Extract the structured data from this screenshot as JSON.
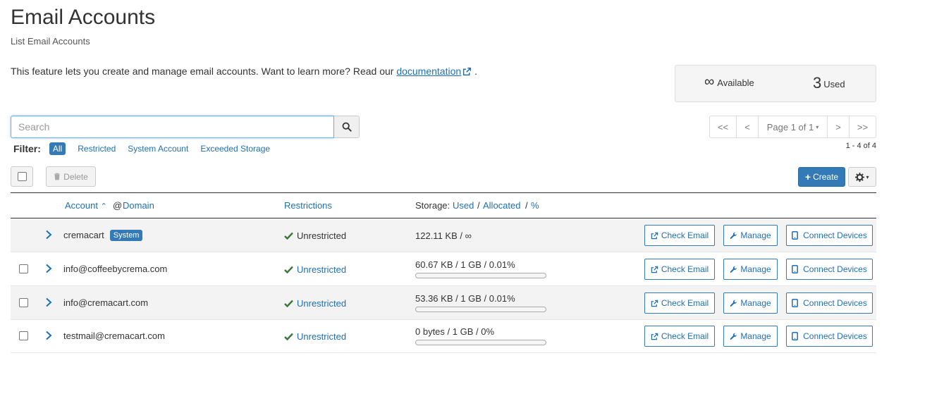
{
  "header": {
    "title": "Email Accounts",
    "subtitle": "List Email Accounts"
  },
  "intro": {
    "text": "This feature lets you create and manage email accounts. Want to learn more? Read our ",
    "link": "documentation",
    "suffix": "."
  },
  "stats": {
    "available_symbol": "∞",
    "available_label": "Available",
    "used_value": "3",
    "used_label": "Used"
  },
  "search": {
    "placeholder": "Search",
    "value": ""
  },
  "filter": {
    "label": "Filter:",
    "options": [
      {
        "label": "All",
        "active": true
      },
      {
        "label": "Restricted",
        "active": false
      },
      {
        "label": "System Account",
        "active": false
      },
      {
        "label": "Exceeded Storage",
        "active": false
      }
    ]
  },
  "pager": {
    "first": "<<",
    "prev": "<",
    "page": "Page 1 of 1",
    "next": ">",
    "last": ">>",
    "range": "1 - 4 of 4"
  },
  "toolbar": {
    "delete_label": "Delete",
    "create_label": "Create"
  },
  "columns": {
    "account": "Account",
    "at": "@",
    "domain": "Domain",
    "restrictions": "Restrictions",
    "storage": "Storage:",
    "used": "Used",
    "allocated": "Allocated",
    "percent": "%",
    "sep": "/"
  },
  "rows": [
    {
      "account": "cremacart",
      "badge": "System",
      "restriction": "Unrestricted",
      "storage": "122.11 KB / ∞",
      "usage_pct": null,
      "has_checkbox": false
    },
    {
      "account": "info@coffeebycrema.com",
      "badge": "",
      "restriction": "Unrestricted",
      "storage": "60.67 KB / 1 GB / 0.01%",
      "usage_pct": 0.01,
      "has_checkbox": true
    },
    {
      "account": "info@cremacart.com",
      "badge": "",
      "restriction": "Unrestricted",
      "storage": "53.36 KB / 1 GB / 0.01%",
      "usage_pct": 0.01,
      "has_checkbox": true
    },
    {
      "account": "testmail@cremacart.com",
      "badge": "",
      "restriction": "Unrestricted",
      "storage": "0 bytes / 1 GB / 0%",
      "usage_pct": 0,
      "has_checkbox": true
    }
  ],
  "actions": {
    "check_email": "Check Email",
    "manage": "Manage",
    "connect_devices": "Connect Devices"
  },
  "colors": {
    "accent": "#337ab7",
    "link": "#1f6fb5",
    "success": "#3c763d"
  }
}
